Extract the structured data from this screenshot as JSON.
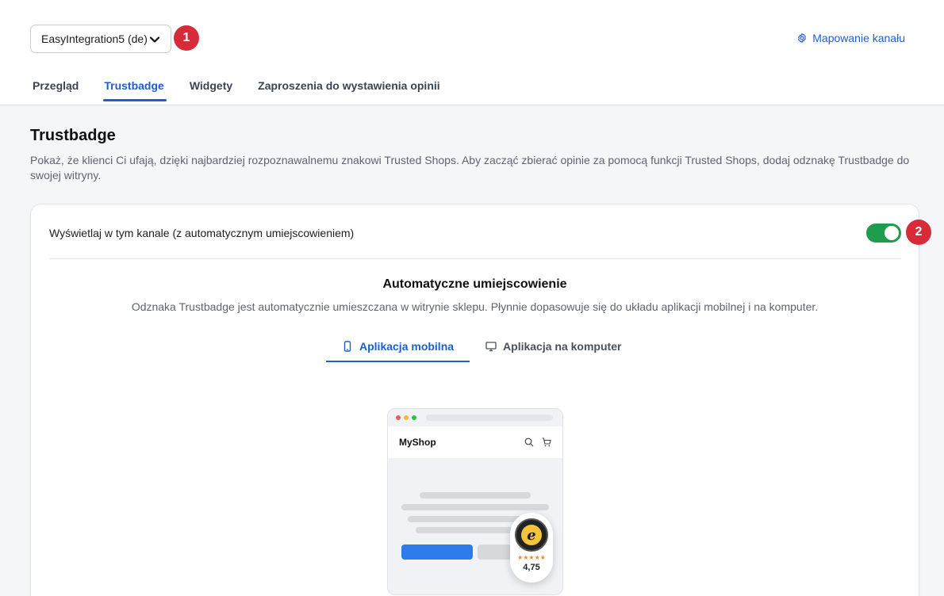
{
  "header": {
    "channel_select": "EasyIntegration5 (de)",
    "step1": "1",
    "map_link": "Mapowanie kanału"
  },
  "tabs": [
    {
      "label": "Przegląd"
    },
    {
      "label": "Trustbadge"
    },
    {
      "label": "Widgety"
    },
    {
      "label": "Zaproszenia do wystawienia opinii"
    }
  ],
  "active_tab": "Trustbadge",
  "page": {
    "title": "Trustbadge",
    "description": "Pokaż, że klienci Ci ufają, dzięki najbardziej rozpoznawalnemu znakowi Trusted Shops. Aby zacząć zbierać opinie za pomocą funkcji Trusted Shops, dodaj odznakę Trustbadge do swojej witryny."
  },
  "card": {
    "toggle_label": "Wyświetlaj w tym kanale (z automatycznym umiejscowieniem)",
    "toggle_on": true,
    "step2": "2",
    "section_title": "Automatyczne umiejscowienie",
    "section_desc": "Odznaka Trustbadge jest automatycznie umieszczana w witrynie sklepu. Płynnie dopasowuje się do układu aplikacji mobilnej i na komputer.",
    "subtabs": [
      {
        "label": "Aplikacja mobilna",
        "icon": "smartphone-icon"
      },
      {
        "label": "Aplikacja na komputer",
        "icon": "monitor-icon"
      }
    ],
    "active_subtab": "Aplikacja mobilna"
  },
  "preview": {
    "shop_name": "MyShop",
    "stars": "★★★★★",
    "rating": "4,75"
  },
  "colors": {
    "accent": "#1b5fd1",
    "toggle_on": "#1f9d4f",
    "step_badge": "#d82b3a"
  }
}
